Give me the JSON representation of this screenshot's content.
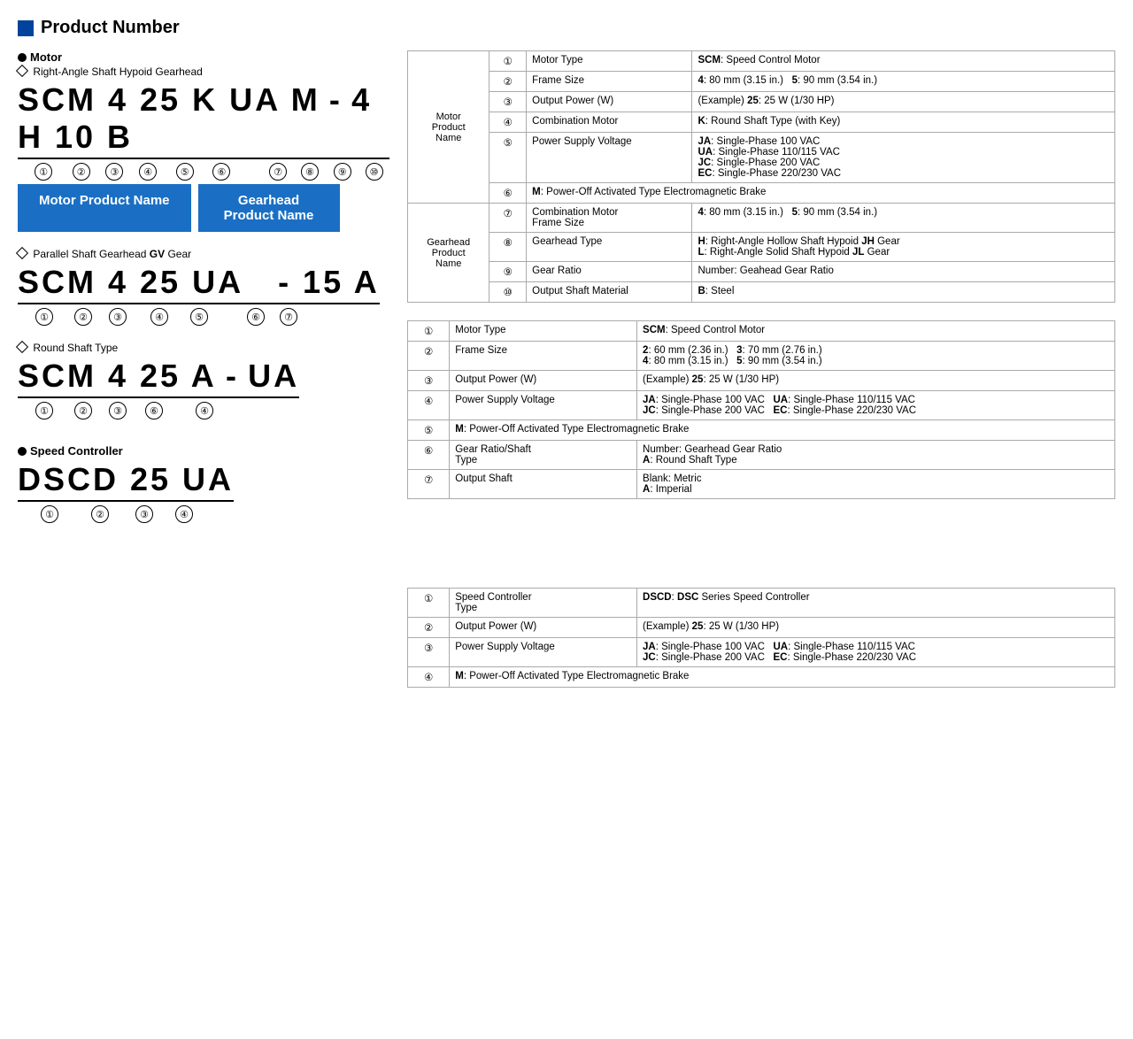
{
  "main_title": "Product Number",
  "section_motor_label": "Motor",
  "section1_subtitle": "Right-Angle Shaft Hypoid Gearhead",
  "section1_code": "SCM 4 25 K UA M - 4 H 10 B",
  "section1_code_parts": [
    "SCM",
    "4",
    "25",
    "K",
    "UA",
    "M",
    "-",
    "4",
    "H",
    "10",
    "B"
  ],
  "section1_nums": [
    "①",
    "②",
    "③",
    "④",
    "⑤",
    "⑥",
    "",
    "⑦",
    "⑧",
    "⑨",
    "⑩"
  ],
  "motor_product_name": "Motor Product Name",
  "gearhead_product_name": "Gearhead\nProduct Name",
  "section2_subtitle": "Parallel Shaft Gearhead GV Gear",
  "section2_code_parts": [
    "SCM",
    "4",
    "25",
    "UA",
    "",
    "-",
    "15",
    "A"
  ],
  "section2_nums": [
    "①",
    "②",
    "③",
    "④",
    "⑤",
    "",
    "⑥",
    "⑦"
  ],
  "section3_subtitle": "Round Shaft Type",
  "section3_code_parts": [
    "SCM",
    "4",
    "25",
    "A",
    "-",
    "UA"
  ],
  "section3_nums": [
    "①",
    "②",
    "③",
    "⑥",
    "",
    "④"
  ],
  "speed_controller_label": "Speed Controller",
  "section4_code_parts": [
    "DSCD",
    "25",
    "UA"
  ],
  "section4_nums": [
    "①",
    "②",
    "③",
    "④"
  ],
  "table1": {
    "group_rows": [
      {
        "group": "Motor\nProduct\nName",
        "rows": [
          {
            "num": "①",
            "label": "Motor Type",
            "value": "<b>SCM</b>: Speed Control Motor"
          },
          {
            "num": "②",
            "label": "Frame Size",
            "value": "<b>4</b>: 80 mm (3.15 in.)   <b>5</b>: 90 mm (3.54 in.)"
          },
          {
            "num": "③",
            "label": "Output Power (W)",
            "value": "(Example) <b>25</b>: 25 W (1/30 HP)"
          },
          {
            "num": "④",
            "label": "Combination Motor",
            "value": "<b>K</b>: Round Shaft Type (with Key)"
          },
          {
            "num": "⑤",
            "label": "Power Supply Voltage",
            "value": "<b>JA</b>: Single-Phase 100 VAC\n<b>UA</b>: Single-Phase 110/115 VAC\n<b>JC</b>: Single-Phase 200 VAC\n<b>EC</b>: Single-Phase 220/230 VAC"
          },
          {
            "num": "⑥",
            "label": "",
            "value": "<b>M</b>: Power-Off Activated Type Electromagnetic Brake",
            "colspan": true
          }
        ]
      },
      {
        "group": "Gearhead\nProduct\nName",
        "rows": [
          {
            "num": "⑦",
            "label": "Combination Motor\nFrame Size",
            "value": "<b>4</b>: 80 mm (3.15 in.)   <b>5</b>: 90 mm (3.54 in.)"
          },
          {
            "num": "⑧",
            "label": "Gearhead Type",
            "value": "<b>H</b>: Right-Angle Hollow Shaft Hypoid <b>JH</b> Gear\n<b>L</b>: Right-Angle Solid Shaft Hypoid <b>JL</b> Gear"
          },
          {
            "num": "⑨",
            "label": "Gear Ratio",
            "value": "Number: Geahead Gear Ratio"
          },
          {
            "num": "⑩",
            "label": "Output Shaft Material",
            "value": "<b>B</b>: Steel"
          }
        ]
      }
    ]
  },
  "table2": {
    "rows": [
      {
        "num": "①",
        "label": "Motor Type",
        "value": "<b>SCM</b>: Speed Control Motor"
      },
      {
        "num": "②",
        "label": "Frame Size",
        "value": "<b>2</b>: 60 mm (2.36 in.)   <b>3</b>: 70 mm (2.76 in.)\n<b>4</b>: 80 mm (3.15 in.)   <b>5</b>: 90 mm (3.54 in.)"
      },
      {
        "num": "③",
        "label": "Output Power (W)",
        "value": "(Example) <b>25</b>: 25 W (1/30 HP)"
      },
      {
        "num": "④",
        "label": "Power Supply Voltage",
        "value": "<b>JA</b>: Single-Phase 100 VAC   <b>UA</b>: Single-Phase 110/115 VAC\n<b>JC</b>: Single-Phase 200 VAC   <b>EC</b>: Single-Phase 220/230 VAC"
      },
      {
        "num": "⑤",
        "label": "",
        "value": "<b>M</b>: Power-Off Activated Type Electromagnetic Brake",
        "colspan": true
      },
      {
        "num": "⑥",
        "label": "Gear Ratio/Shaft\nType",
        "value": "Number: Gearhead Gear Ratio\n<b>A</b>: Round Shaft Type"
      },
      {
        "num": "⑦",
        "label": "Output Shaft",
        "value": "Blank: Metric\n<b>A</b>: Imperial"
      }
    ]
  },
  "table3": {
    "rows": [
      {
        "num": "①",
        "label": "Speed Controller\nType",
        "value": "<b>DSCD</b>: <b>DSC</b> Series Speed Controller"
      },
      {
        "num": "②",
        "label": "Output Power (W)",
        "value": "(Example) <b>25</b>: 25 W (1/30 HP)"
      },
      {
        "num": "③",
        "label": "Power Supply Voltage",
        "value": "<b>JA</b>: Single-Phase 100 VAC   <b>UA</b>: Single-Phase 110/115 VAC\n<b>JC</b>: Single-Phase 200 VAC   <b>EC</b>: Single-Phase 220/230 VAC"
      },
      {
        "num": "④",
        "label": "",
        "value": "<b>M</b>: Power-Off Activated Type Electromagnetic Brake",
        "colspan": true
      }
    ]
  }
}
